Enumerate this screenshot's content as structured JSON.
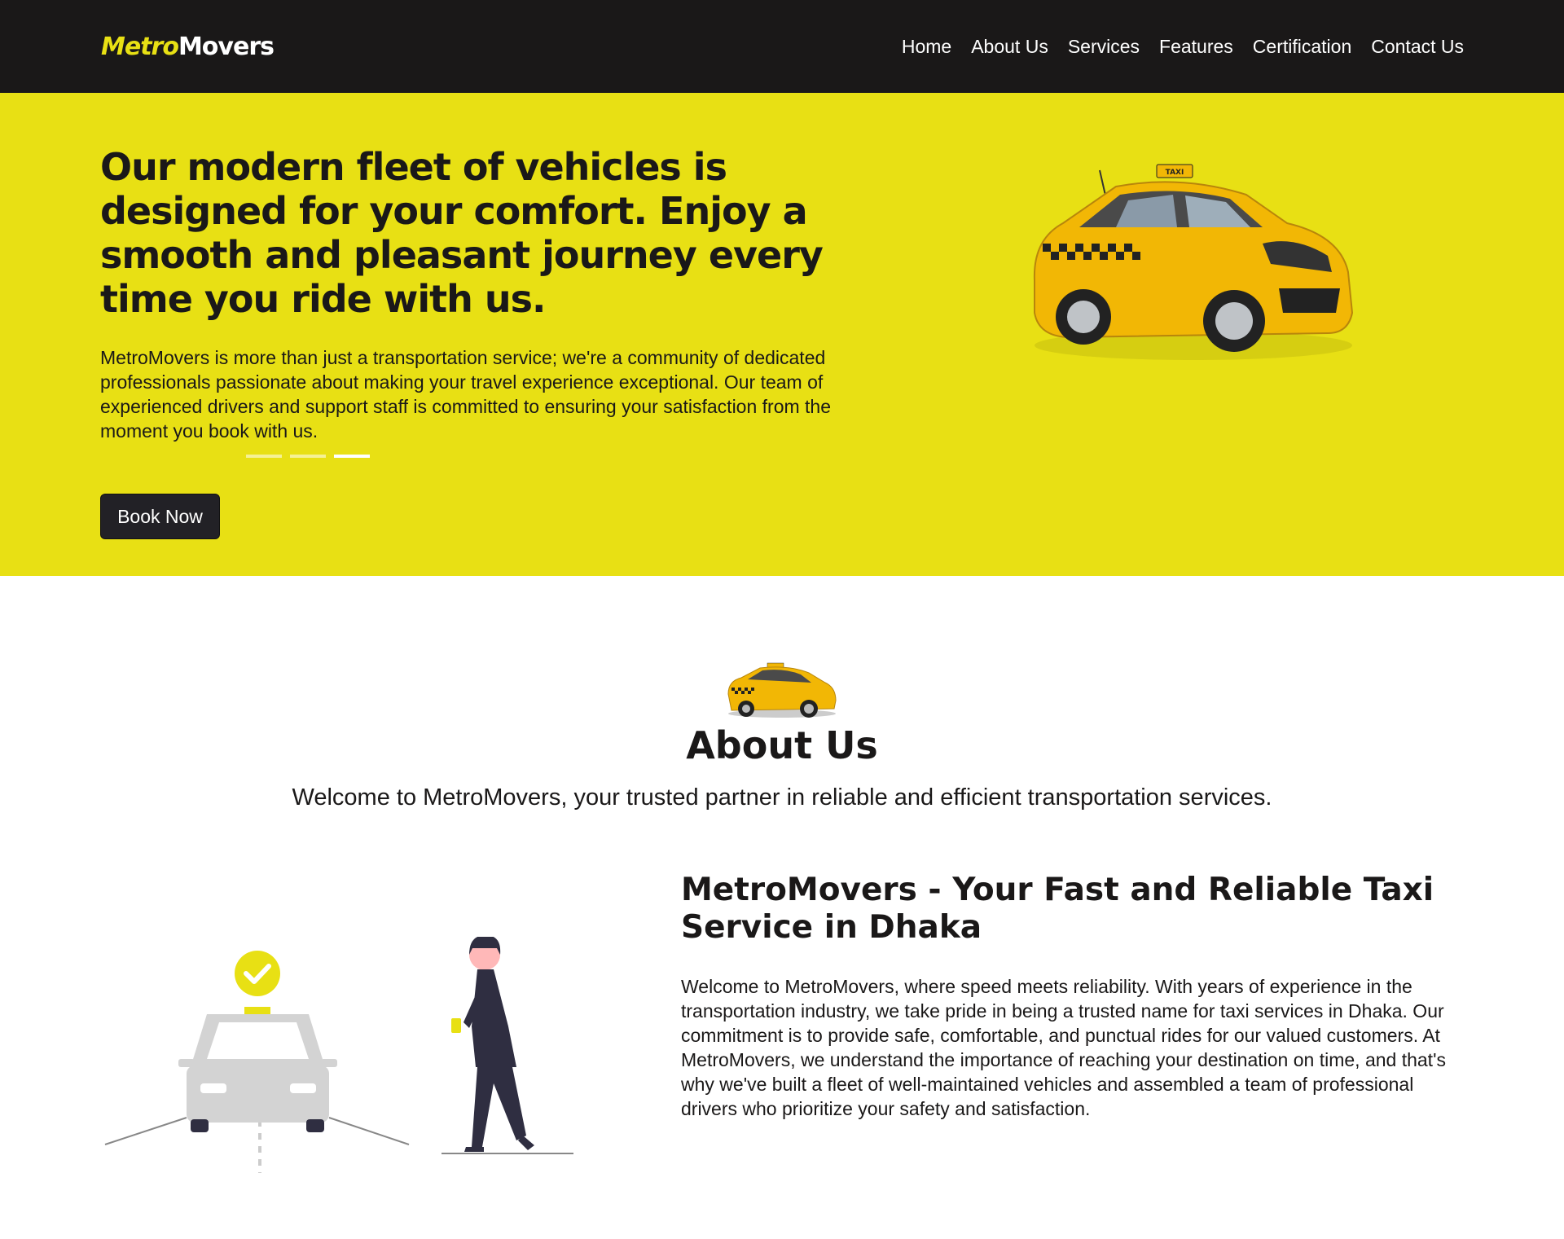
{
  "brand": {
    "part1": "Metro",
    "part2": "Movers"
  },
  "nav": {
    "items": [
      {
        "label": "Home"
      },
      {
        "label": "About Us"
      },
      {
        "label": "Services"
      },
      {
        "label": "Features"
      },
      {
        "label": "Certification"
      },
      {
        "label": "Contact Us"
      }
    ]
  },
  "hero": {
    "title": "Our modern fleet of vehicles is designed for your comfort. Enjoy a smooth and pleasant journey every time you ride with us.",
    "text": "MetroMovers is more than just a transportation service; we're a community of dedicated professionals passionate about making your travel experience exceptional. Our team of experienced drivers and support staff is committed to ensuring your satisfaction from the moment you book with us.",
    "cta_label": "Book Now",
    "taxi_sign": "TAXI",
    "carousel": {
      "slide_count": 3,
      "active_slide": 3
    }
  },
  "about": {
    "title": "About Us",
    "subtitle": "Welcome to MetroMovers, your trusted partner in reliable and efficient transportation services.",
    "section_title": "MetroMovers - Your Fast and Reliable Taxi Service in Dhaka",
    "section_text": "Welcome to MetroMovers, where speed meets reliability. With years of experience in the transportation industry, we take pride in being a trusted name for taxi services in Dhaka. Our commitment is to provide safe, comfortable, and punctual rides for our valued customers. At MetroMovers, we understand the importance of reaching your destination on time, and that's why we've built a fleet of well-maintained vehicles and assembled a team of professional drivers who prioritize your safety and satisfaction."
  },
  "colors": {
    "accent": "#e8e014",
    "dark": "#1a1818",
    "button": "#222126",
    "taxi_yellow": "#f2b705",
    "illustration_gray": "#d3d3d3",
    "illustration_dark": "#2f2e41"
  },
  "icons": [
    "taxi-car-image",
    "small-taxi-icon",
    "check-circle-icon",
    "taxi-illustration",
    "person-with-phone-illustration"
  ]
}
